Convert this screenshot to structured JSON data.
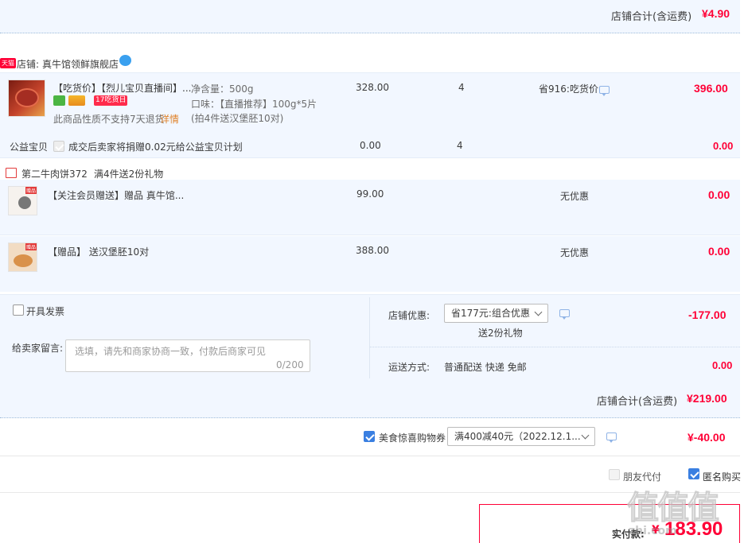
{
  "top_total": {
    "label": "店铺合计(含运费)",
    "amount": "¥4.90"
  },
  "shop": {
    "badge": "天猫",
    "label": "店铺:",
    "name": "真牛馆领鲜旗舰店"
  },
  "item1": {
    "title": "【吃货价】【烈儿宝贝直播间】...",
    "promo_tag": "17吃货日",
    "no_return": "此商品性质不支持7天退货",
    "detail_link": "详情",
    "spec_weight": "净含量：500g",
    "spec_flavor": "口味：【直播推荐】100g*5片",
    "spec_note": "(拍4件送汉堡胚10对)",
    "unit_price": "328.00",
    "qty": "4",
    "discount": "省916:吃货价",
    "subtotal": "396.00"
  },
  "charity": {
    "label": "公益宝贝",
    "text": "成交后卖家将捐赠0.02元给公益宝贝计划",
    "price": "0.00",
    "qty": "4",
    "subtotal": "0.00"
  },
  "gift_promo": {
    "name": "第二牛肉饼372",
    "rule": "满4件送2份礼物"
  },
  "gift1": {
    "thumb_tag": "赠品",
    "title": "【关注会员赠送】赠品 真牛馆...",
    "price": "99.00",
    "discount": "无优惠",
    "subtotal": "0.00"
  },
  "gift2": {
    "thumb_tag": "赠品",
    "title": "【赠品】 送汉堡胚10对",
    "price": "388.00",
    "discount": "无优惠",
    "subtotal": "0.00"
  },
  "invoice": {
    "label": "开具发票"
  },
  "message": {
    "label": "给卖家留言:",
    "placeholder": "选填，请先和商家协商一致，付款后商家可见",
    "counter": "0/200"
  },
  "shop_discount": {
    "label": "店铺优惠:",
    "selected": "省177元:组合优惠",
    "note": "送2份礼物",
    "amount": "-177.00"
  },
  "shipping": {
    "label": "运送方式:",
    "method": "普通配送 快递 免邮",
    "amount": "0.00"
  },
  "shop_total": {
    "label": "店铺合计(含运费)",
    "amount": "¥219.00"
  },
  "coupon": {
    "label": "美食惊喜购物券",
    "selected": "满400减40元（2022.12.1...",
    "amount": "¥-40.00"
  },
  "options": {
    "friend_pay": "朋友代付",
    "anonymous": "匿名购买"
  },
  "final": {
    "label": "实付款:",
    "currency": "¥",
    "amount": "183.90"
  },
  "watermark": {
    "text": "值值值",
    "sub": "zhi.com"
  },
  "colors": {
    "price_red": "#ff0036",
    "band_blue": "#f2f7ff",
    "accent_blue": "#3a7fe1"
  }
}
